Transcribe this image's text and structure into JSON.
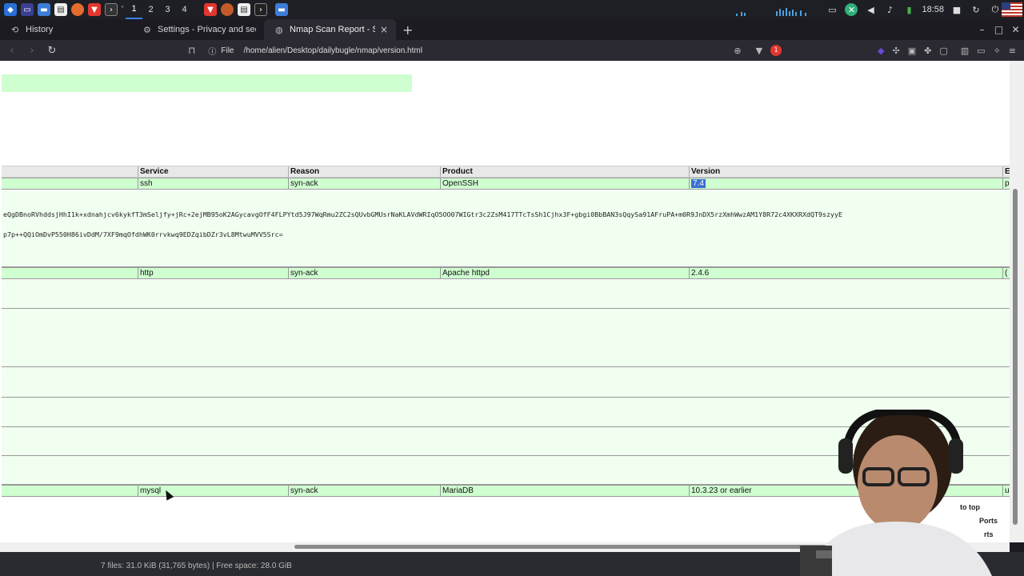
{
  "taskbar": {
    "workspaces": [
      "1",
      "2",
      "3",
      "4"
    ],
    "clock": "18:58",
    "icons": [
      "kali-menu-icon",
      "app-drawer-icon",
      "folder-icon",
      "file-icon",
      "firefox-icon",
      "brave-icon",
      "terminal-icon",
      "brave-icon",
      "firefox-icon",
      "document-icon",
      "terminal-icon",
      "folder-icon"
    ]
  },
  "tabs": [
    {
      "title": "History",
      "icon": "history-icon"
    },
    {
      "title": "Settings - Privacy and security",
      "icon": "gear-icon"
    },
    {
      "title": "Nmap Scan Report - Scan",
      "icon": "globe-icon",
      "close": "×"
    }
  ],
  "toolbar": {
    "scheme": "File",
    "url": "/home/alien/Desktop/dailybugle/nmap/version.html",
    "brave_badge": "1"
  },
  "table": {
    "headers": [
      "Service",
      "Reason",
      "Product",
      "Version",
      "E"
    ],
    "rows": [
      {
        "service": "ssh",
        "reason": "syn-ack",
        "product": "OpenSSH",
        "version": "7.4",
        "extra": "p"
      },
      {
        "service": "http",
        "reason": "syn-ack",
        "product": "Apache httpd",
        "version": "2.4.6",
        "extra": "("
      },
      {
        "service": "mysql",
        "reason": "syn-ack",
        "product": "MariaDB",
        "version": "10.3.23 or earlier",
        "extra": "u"
      }
    ],
    "fingerprint_line1": "eQgDBnoRVhddsjHhI1k+xdnahjcv6kykfT3mSeljfy+jRc+2ejMB95oK2AGycavgOfF4FLPYtd5J97WqRmu2ZC2sQUvbGMUsrNaKLAVdWRIqO5OO07WIGtr3c2ZsM417TTcTsSh1Cjhx3F+gbgi0BbBAN3sQqySa91AFruPA+m0R9JnDX5rzXmhWwzAM1Y8R72c4XKXRXdQT9szyyE",
    "fingerprint_line2": "p7p++QQiOmDvP550H86ivDdM/7XF9mqOfdhWK0rrvkwq9EDZqibDZr3vL8MtwuMVV5Src="
  },
  "floating_links": [
    "to top",
    "Ports",
    "rts"
  ],
  "status_bar": "7 files: 31.0 KiB (31,765 bytes) | Free space: 28.0 GiB"
}
